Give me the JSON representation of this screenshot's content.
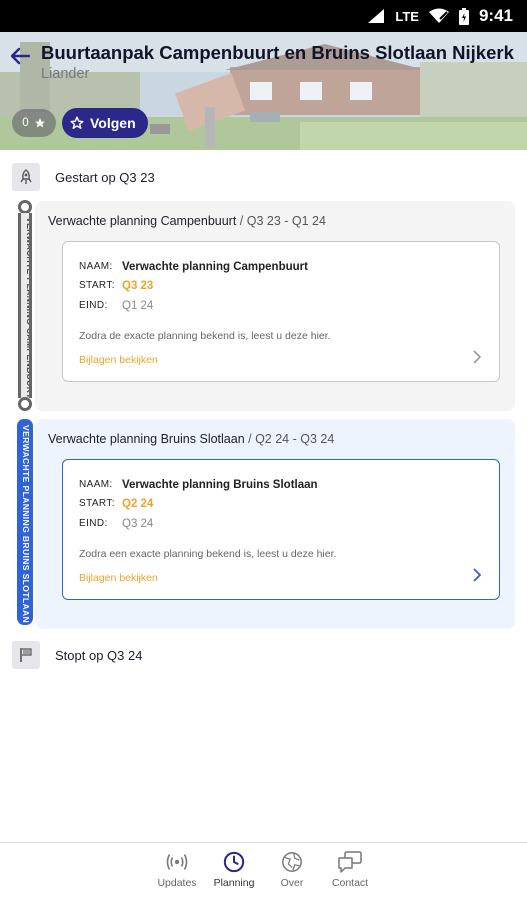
{
  "status_bar": {
    "network": "LTE",
    "time": "9:41"
  },
  "header": {
    "title": "Buurtaanpak Campenbuurt en Bruins Slotlaan Nijkerk",
    "subtitle": "Liander",
    "follower_count": "0",
    "follow_label": "Volgen",
    "accent_color": "#2b2889"
  },
  "timeline": {
    "start": {
      "label": "Gestart op Q3 23",
      "icon": "rocket-icon"
    },
    "phases": [
      {
        "rail_label": "VERWACHTE PLANNING CAMPENBUURT",
        "title": "Verwachte planning Campenbuurt",
        "range": " / Q3 23 - Q1 24",
        "card": {
          "name_key": "NAAM:",
          "name_value": "Verwachte planning Campenbuurt",
          "start_key": "START:",
          "start_value": "Q3 23",
          "end_key": "EIND:",
          "end_value": "Q1 24",
          "description": "Zodra de exacte planning bekend is, leest u deze hier.",
          "link": "Bijlagen bekijken"
        }
      },
      {
        "rail_label": "VERWACHTE PLANNING BRUINS SLOTLAAN",
        "title": "Verwachte planning Bruins Slotlaan",
        "range": " / Q2 24 - Q3 24",
        "card": {
          "name_key": "NAAM:",
          "name_value": "Verwachte planning Bruins Slotlaan",
          "start_key": "START:",
          "start_value": "Q2 24",
          "end_key": "EIND:",
          "end_value": "Q3 24",
          "description": "Zodra een exacte planning bekend is, leest u deze hier.",
          "link": "Bijlagen bekijken"
        }
      }
    ],
    "end": {
      "label": "Stopt op Q3 24",
      "icon": "flag-icon"
    }
  },
  "bottom_nav": {
    "items": [
      {
        "label": "Updates",
        "icon": "broadcast-icon"
      },
      {
        "label": "Planning",
        "icon": "clock-icon",
        "active": true
      },
      {
        "label": "Over",
        "icon": "globe-icon"
      },
      {
        "label": "Contact",
        "icon": "chat-icon"
      }
    ]
  },
  "colors": {
    "orange": "#f1a22b",
    "active_blue": "#2f63d8",
    "active_panel": "#eef4fd"
  }
}
